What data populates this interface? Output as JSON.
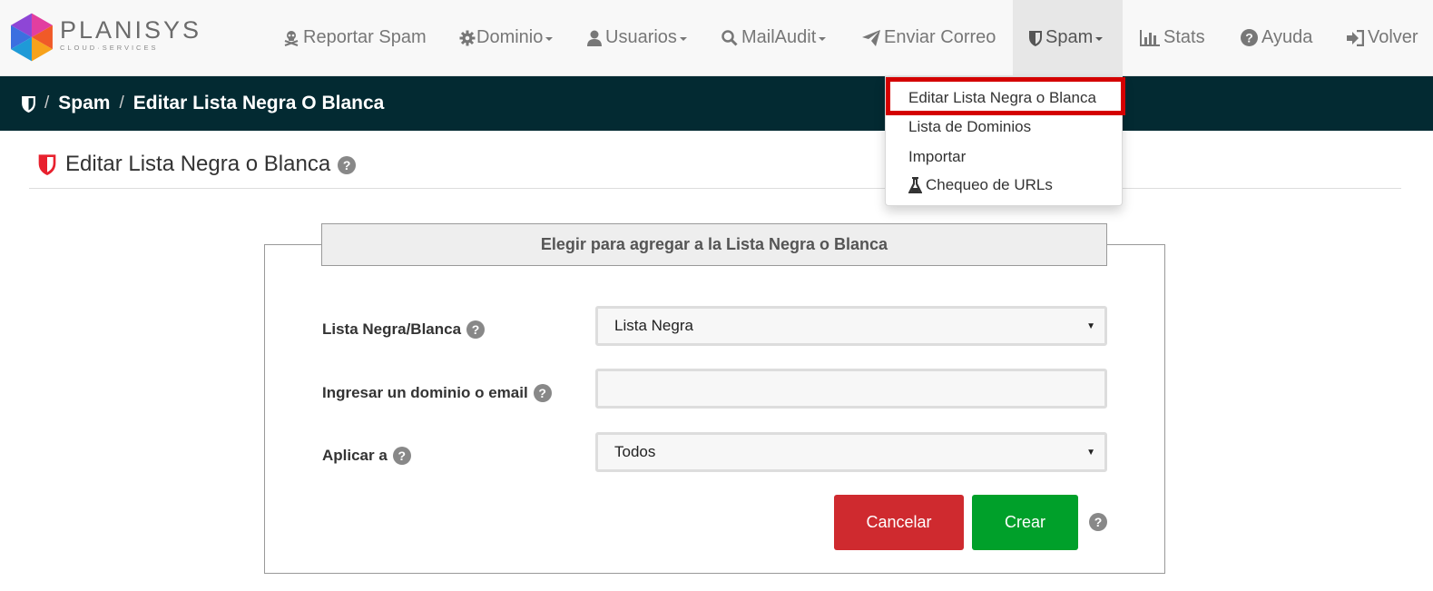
{
  "brand": {
    "name": "PLANISYS",
    "tagline": "CLOUD·SERVICES"
  },
  "nav": {
    "report_spam": "Reportar Spam",
    "domain": "Dominio",
    "users": "Usuarios",
    "mailaudit": "MailAudit",
    "send_mail": "Enviar Correo",
    "spam": "Spam",
    "stats": "Stats",
    "help": "Ayuda",
    "back": "Volver"
  },
  "breadcrumb": {
    "section": "Spam",
    "current": "Editar Lista Negra O Blanca"
  },
  "spam_menu": {
    "items": [
      {
        "label": "Editar Lista Negra o Blanca",
        "icon": "none",
        "highlighted": true
      },
      {
        "label": "Lista de Dominios",
        "icon": "none"
      },
      {
        "label": "Importar",
        "icon": "none"
      },
      {
        "label": "Chequeo de URLs",
        "icon": "flask-icon"
      }
    ]
  },
  "page": {
    "title": "Editar Lista Negra o Blanca",
    "help_glyph": "?"
  },
  "form": {
    "legend": "Elegir para agregar a la Lista Negra o Blanca",
    "list_type": {
      "label": "Lista Negra/Blanca",
      "value": "Lista Negra"
    },
    "entry": {
      "label": "Ingresar un dominio o email",
      "value": ""
    },
    "apply_to": {
      "label": "Aplicar a",
      "value": "Todos"
    },
    "cancel_label": "Cancelar",
    "create_label": "Crear"
  },
  "colors": {
    "navbar_bg": "#f8f8f8",
    "breadcrumb_bg": "#032a32",
    "cancel_button": "#cf2a2f",
    "create_button": "#00a02a",
    "highlight_box": "#d40000",
    "shield_accent": "#e8212e"
  }
}
